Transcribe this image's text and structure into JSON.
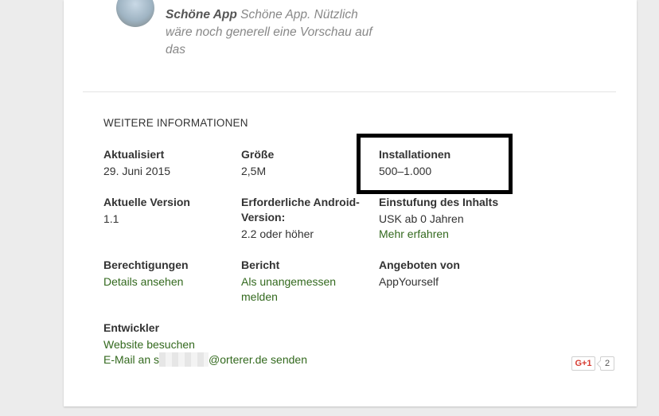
{
  "review": {
    "author": "Schöne App",
    "text": "Schöne App. Nützlich wäre noch generell eine Vorschau auf das"
  },
  "additional_info": {
    "title": "WEITERE INFORMATIONEN",
    "updated": {
      "label": "Aktualisiert",
      "value": "29. Juni 2015"
    },
    "size": {
      "label": "Größe",
      "value": "2,5M"
    },
    "installs": {
      "label": "Installationen",
      "value": "500–1.000"
    },
    "version": {
      "label": "Aktuelle Version",
      "value": "1.1"
    },
    "android": {
      "label": "Erforderliche Android-Version:",
      "value": "2.2 oder höher"
    },
    "rating": {
      "label": "Einstufung des Inhalts",
      "value": "USK ab 0 Jahren",
      "link": "Mehr erfahren"
    },
    "permissions": {
      "label": "Berechtigungen",
      "link": "Details ansehen"
    },
    "report": {
      "label": "Bericht",
      "link": "Als unangemessen melden"
    },
    "offered_by": {
      "label": "Angeboten von",
      "value": "AppYourself"
    },
    "developer": {
      "label": "Entwickler",
      "website_link": "Website besuchen",
      "email_prefix": "E-Mail an s",
      "email_suffix": "@orterer.de senden"
    }
  },
  "gplus": {
    "label": "G+1",
    "count": "2"
  },
  "colors": {
    "link": "#33691e",
    "highlight_border": "#000000",
    "gplus_red": "#d73d32"
  }
}
